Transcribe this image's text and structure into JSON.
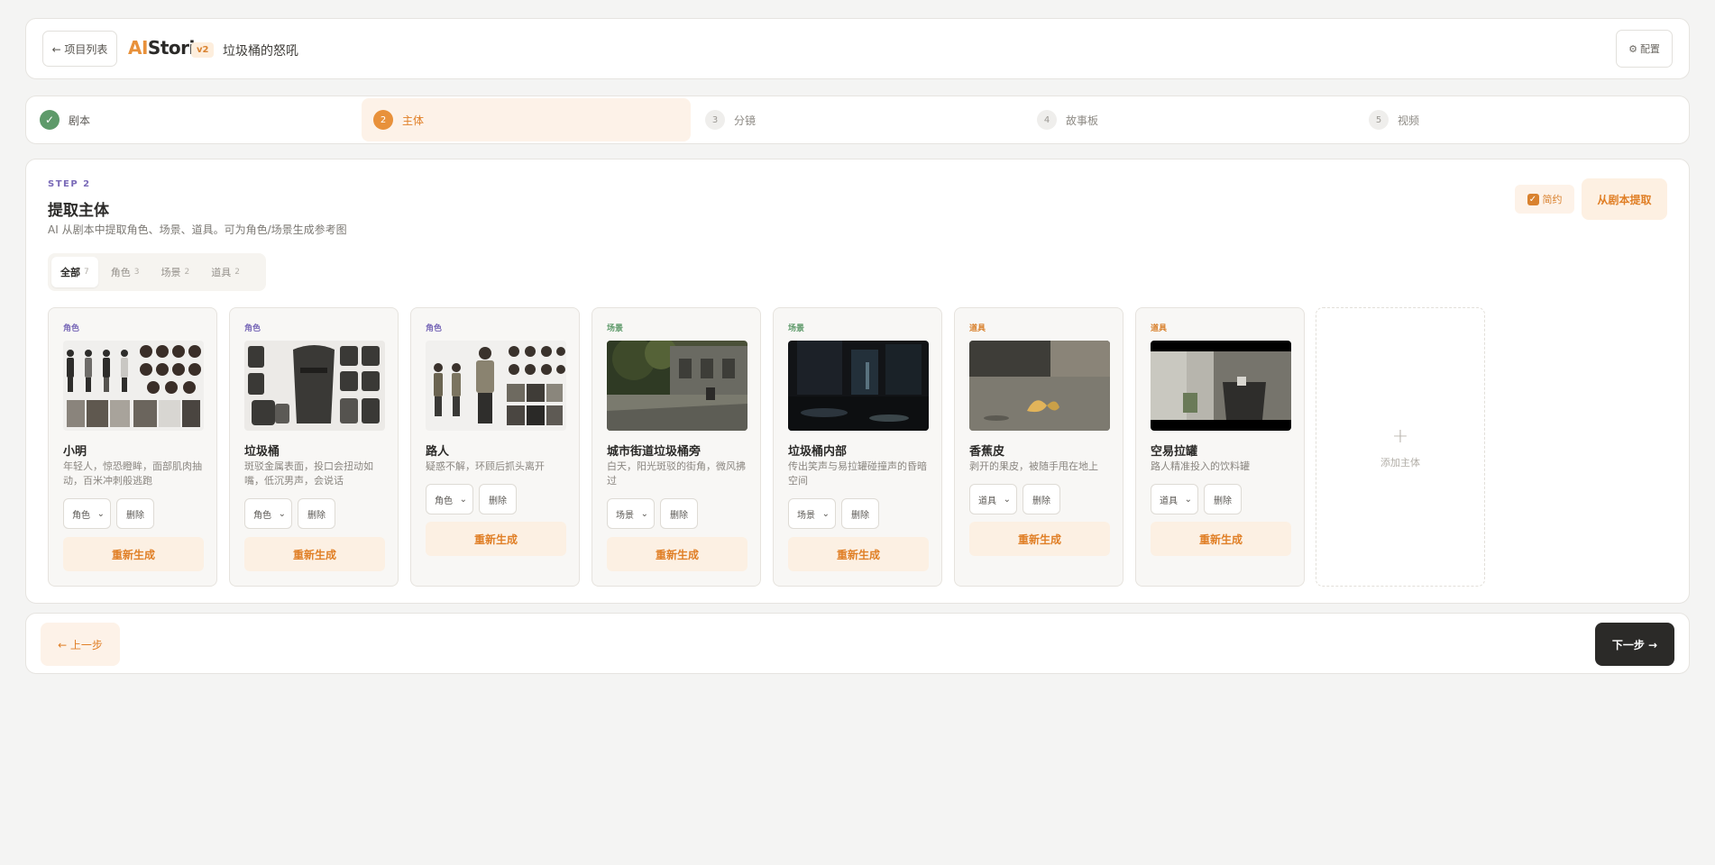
{
  "header": {
    "back_label": "← 项目列表",
    "logo_ai": "AI",
    "logo_rest": "Stori",
    "version": "v2",
    "project_name": "垃圾桶的怒吼",
    "config_icon": "gear-icon",
    "config_label": "配置"
  },
  "stepper": [
    {
      "num": "✓",
      "label": "剧本",
      "state": "done"
    },
    {
      "num": "2",
      "label": "主体",
      "state": "active"
    },
    {
      "num": "3",
      "label": "分镜",
      "state": "pending"
    },
    {
      "num": "4",
      "label": "故事板",
      "state": "pending"
    },
    {
      "num": "5",
      "label": "视频",
      "state": "pending"
    }
  ],
  "main": {
    "step_tag": "STEP 2",
    "title": "提取主体",
    "subtitle": "AI 从剧本中提取角色、场景、道具。可为角色/场景生成参考图",
    "simple_label": "简约",
    "simple_checked": true,
    "extract_label": "从剧本提取",
    "filter_tabs": [
      {
        "label": "全部",
        "count": "7"
      },
      {
        "label": "角色",
        "count": "3"
      },
      {
        "label": "场景",
        "count": "2"
      },
      {
        "label": "道具",
        "count": "2"
      }
    ],
    "cards": [
      {
        "type": "角色",
        "name": "小明",
        "desc": "年轻人，惊恐瞪眸，面部肌肉抽动，百米冲刺般逃跑",
        "select": "角色",
        "delete": "删除",
        "regen": "重新生成"
      },
      {
        "type": "角色",
        "name": "垃圾桶",
        "desc": "斑驳金属表面，投口会扭动如嘴，低沉男声，会说话",
        "select": "角色",
        "delete": "删除",
        "regen": "重新生成"
      },
      {
        "type": "角色",
        "name": "路人",
        "desc": "疑惑不解，环顾后抓头离开",
        "select": "角色",
        "delete": "删除",
        "regen": "重新生成"
      },
      {
        "type": "场景",
        "name": "城市街道垃圾桶旁",
        "desc": "白天，阳光斑驳的街角，微风拂过",
        "select": "场景",
        "delete": "删除",
        "regen": "重新生成"
      },
      {
        "type": "场景",
        "name": "垃圾桶内部",
        "desc": "传出笑声与易拉罐碰撞声的昏暗空间",
        "select": "场景",
        "delete": "删除",
        "regen": "重新生成"
      },
      {
        "type": "道具",
        "name": "香蕉皮",
        "desc": "剥开的果皮，被随手甩在地上",
        "select": "道具",
        "delete": "删除",
        "regen": "重新生成"
      },
      {
        "type": "道具",
        "name": "空易拉罐",
        "desc": "路人精准投入的饮料罐",
        "select": "道具",
        "delete": "删除",
        "regen": "重新生成"
      }
    ],
    "add_label": "添加主体"
  },
  "footer": {
    "prev_label": "← 上一步",
    "next_label": "下一步 →"
  },
  "colors": {
    "accent": "#e8913b",
    "role": "#7a6ab8",
    "scene": "#5e9a6a",
    "prop": "#d9822f",
    "done": "#5e9a6a"
  }
}
